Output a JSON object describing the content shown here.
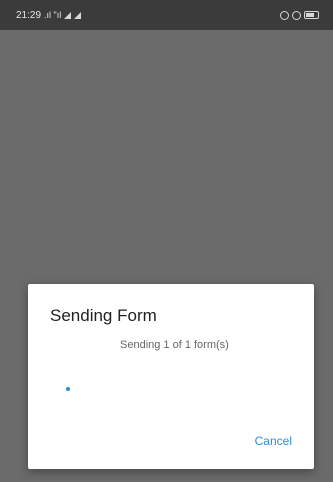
{
  "status_bar": {
    "time": "21:29",
    "signal_text": ".ıl \"ıl"
  },
  "dialog": {
    "title": "Sending Form",
    "message": "Sending 1 of 1 form(s)",
    "cancel_label": "Cancel"
  },
  "colors": {
    "accent": "#2b8fd6",
    "scrim": "#6b6b6b",
    "status_bar": "#3b3b3b"
  },
  "icons": [
    "signal-icon",
    "location-icon",
    "alarm-icon",
    "battery-icon"
  ]
}
